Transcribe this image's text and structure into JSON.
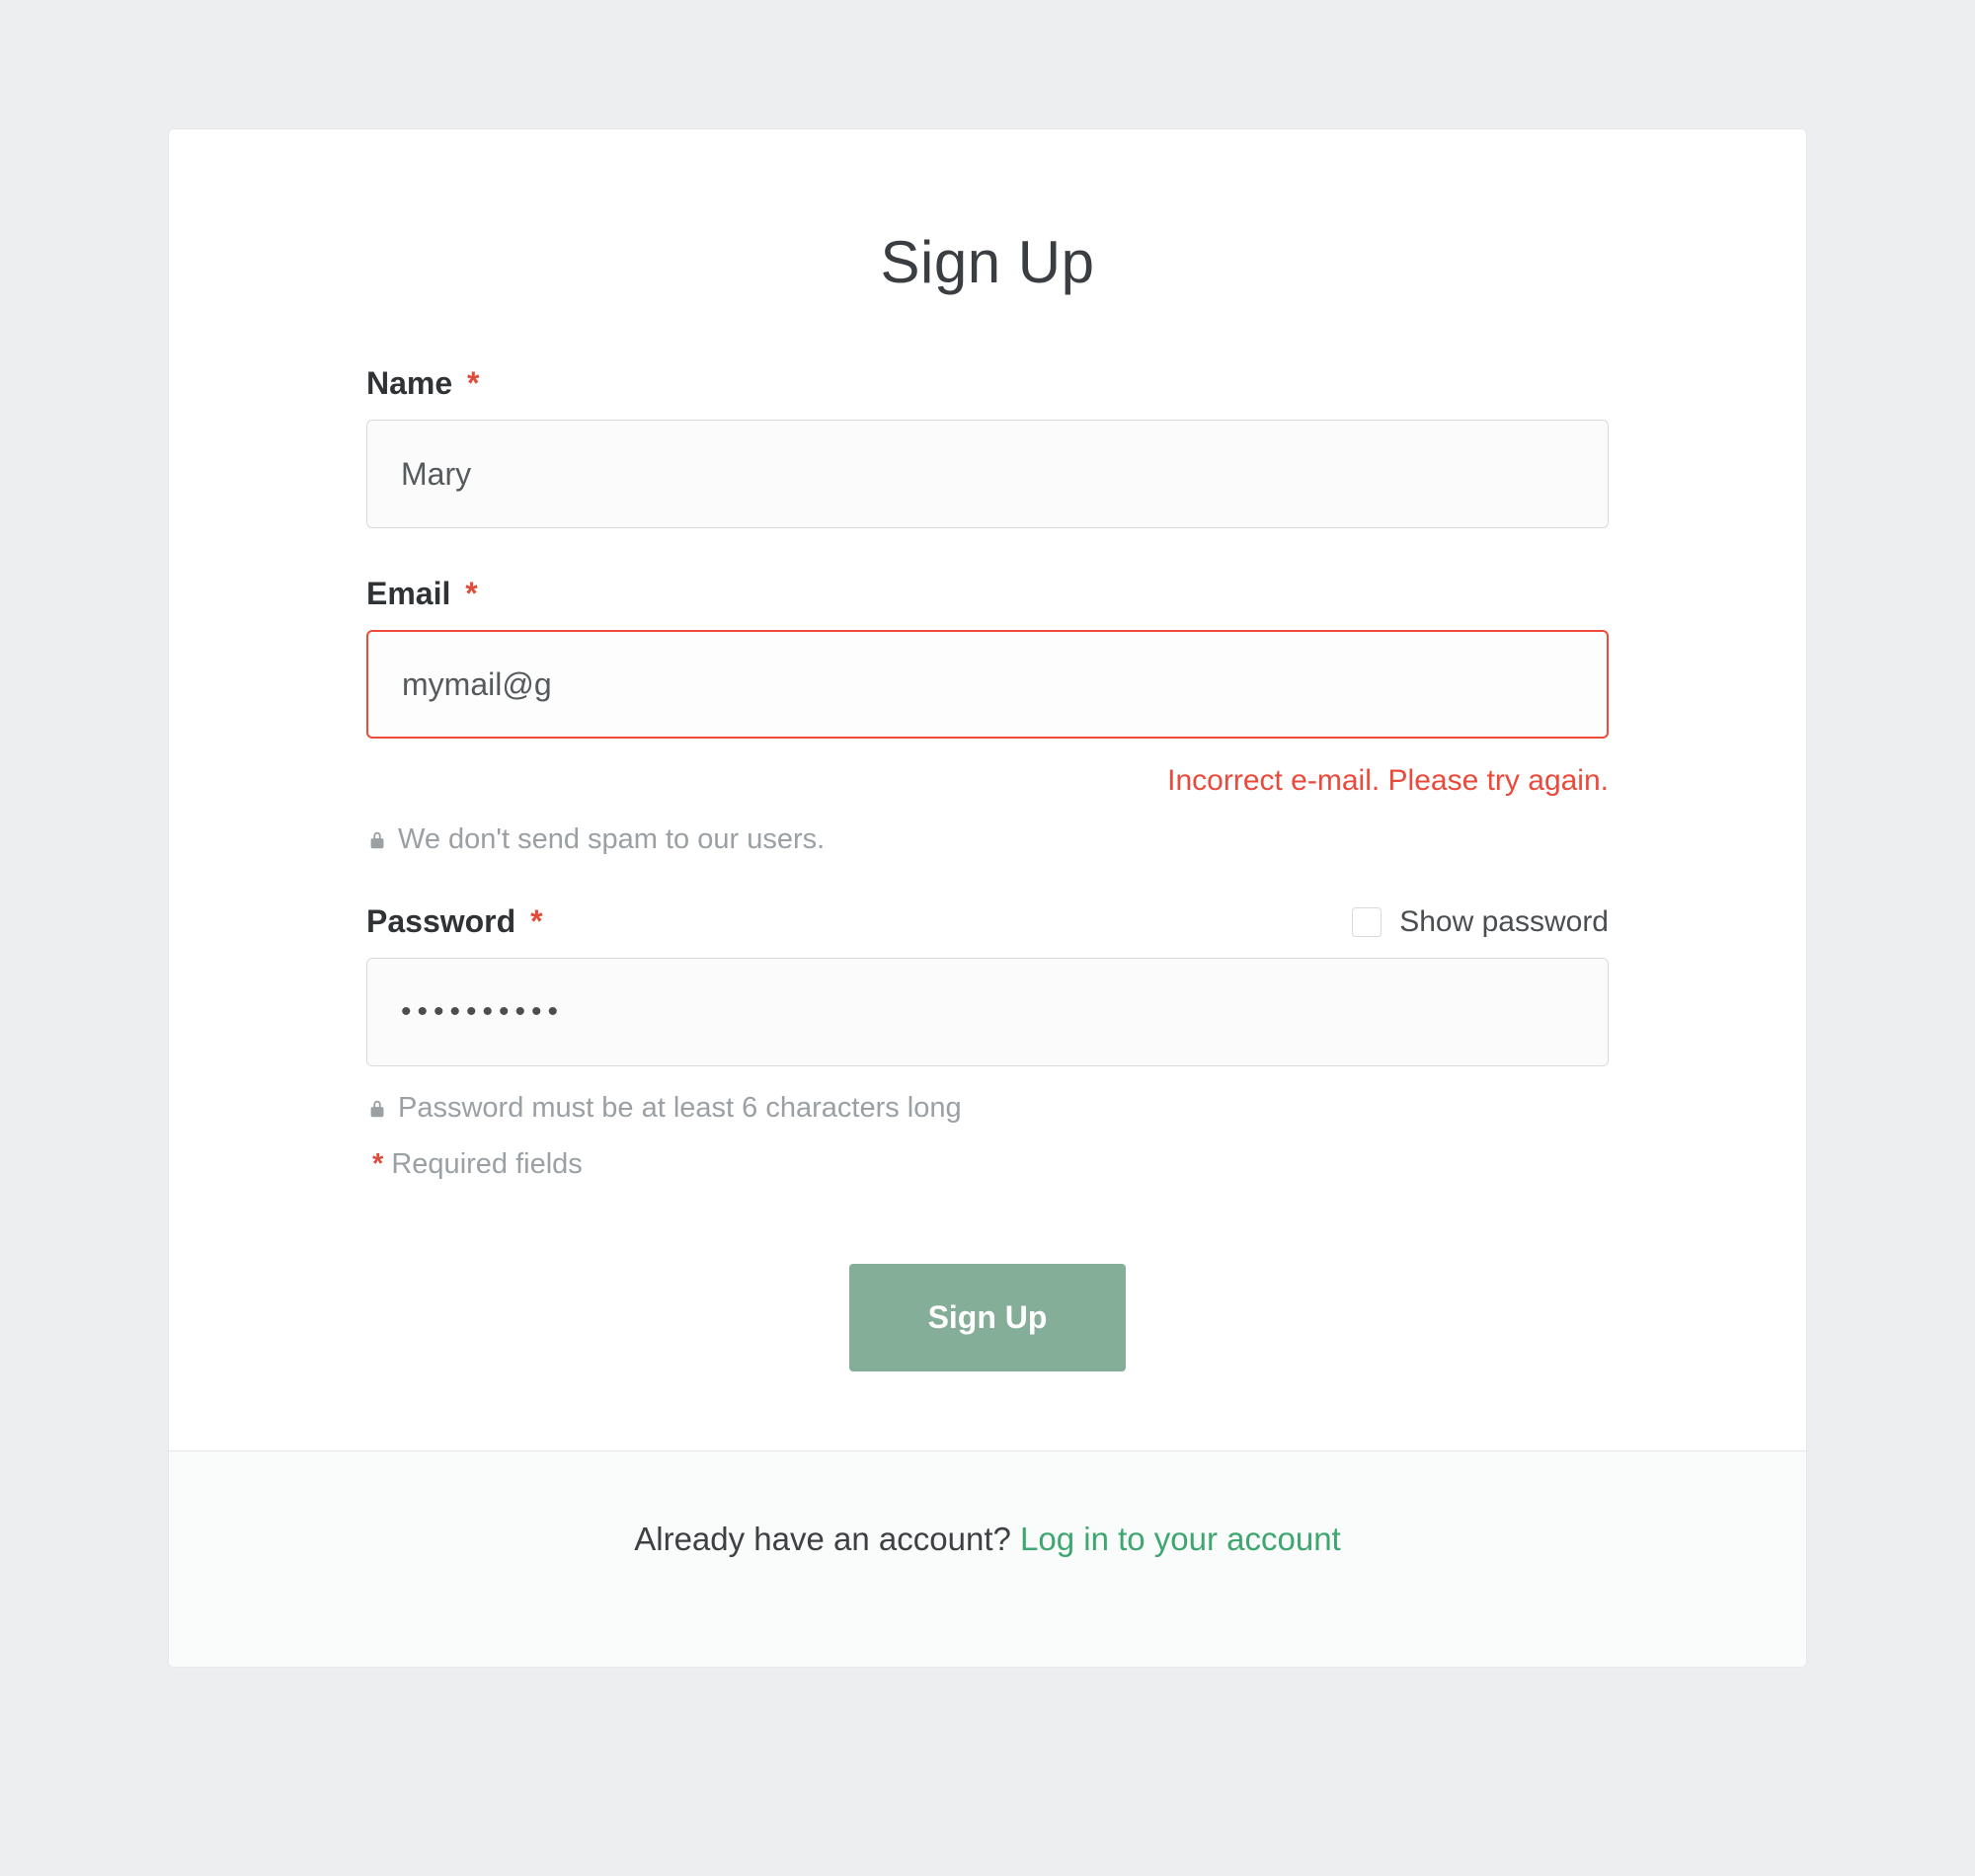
{
  "title": "Sign Up",
  "fields": {
    "name": {
      "label": "Name",
      "value": "Mary"
    },
    "email": {
      "label": "Email",
      "value": "mymail@g",
      "error": "Incorrect e-mail. Please try again.",
      "hint": "We don't send spam to our users."
    },
    "password": {
      "label": "Password",
      "value_mask": "••••••••••",
      "show_label": "Show password",
      "hint": "Password must be at least 6 characters long"
    }
  },
  "required_marker": "*",
  "required_note": "Required fields",
  "submit_label": "Sign Up",
  "footer": {
    "prompt": "Already have an account? ",
    "link": "Log in to your account"
  }
}
